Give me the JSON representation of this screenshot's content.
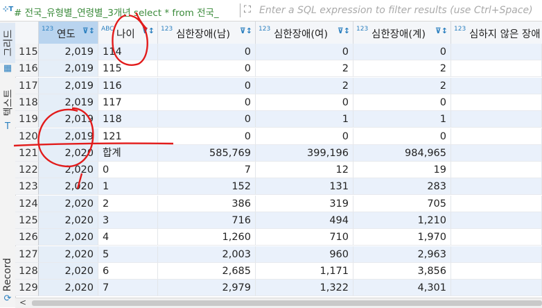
{
  "toolbar": {
    "query_text": "# 전국_유형별_연령별_3개년 select * from 전국_",
    "filter_placeholder": "Enter a SQL expression to filter results (use Ctrl+Space)"
  },
  "sidebar": {
    "tabs": [
      "그리드",
      "텍스트",
      "Record"
    ]
  },
  "columns": [
    {
      "type": "123",
      "name": "연도"
    },
    {
      "type": "ABC",
      "name": "나이"
    },
    {
      "type": "123",
      "name": "심한장애(남)"
    },
    {
      "type": "123",
      "name": "심한장애(여)"
    },
    {
      "type": "123",
      "name": "심한장애(계)"
    },
    {
      "type": "123",
      "name": "심하지 않은 장애"
    }
  ],
  "rows": [
    {
      "n": "115",
      "year": "2,019",
      "age": "114",
      "m": "0",
      "f": "0",
      "t": "0"
    },
    {
      "n": "116",
      "year": "2,019",
      "age": "115",
      "m": "0",
      "f": "2",
      "t": "2"
    },
    {
      "n": "117",
      "year": "2,019",
      "age": "116",
      "m": "0",
      "f": "2",
      "t": "2"
    },
    {
      "n": "118",
      "year": "2,019",
      "age": "117",
      "m": "0",
      "f": "0",
      "t": "0"
    },
    {
      "n": "119",
      "year": "2,019",
      "age": "118",
      "m": "0",
      "f": "1",
      "t": "1"
    },
    {
      "n": "120",
      "year": "2,019",
      "age": "121",
      "m": "0",
      "f": "0",
      "t": "0"
    },
    {
      "n": "121",
      "year": "2,020",
      "age": "합계",
      "m": "585,769",
      "f": "399,196",
      "t": "984,965"
    },
    {
      "n": "122",
      "year": "2,020",
      "age": "0",
      "m": "7",
      "f": "12",
      "t": "19"
    },
    {
      "n": "123",
      "year": "2,020",
      "age": "1",
      "m": "152",
      "f": "131",
      "t": "283"
    },
    {
      "n": "124",
      "year": "2,020",
      "age": "2",
      "m": "386",
      "f": "319",
      "t": "705"
    },
    {
      "n": "125",
      "year": "2,020",
      "age": "3",
      "m": "716",
      "f": "494",
      "t": "1,210"
    },
    {
      "n": "126",
      "year": "2,020",
      "age": "4",
      "m": "1,260",
      "f": "710",
      "t": "1,970"
    },
    {
      "n": "127",
      "year": "2,020",
      "age": "5",
      "m": "2,003",
      "f": "960",
      "t": "2,963"
    },
    {
      "n": "128",
      "year": "2,020",
      "age": "6",
      "m": "2,685",
      "f": "1,171",
      "t": "3,856"
    },
    {
      "n": "129",
      "year": "2,020",
      "age": "7",
      "m": "2,979",
      "f": "1,322",
      "t": "4,301"
    }
  ]
}
